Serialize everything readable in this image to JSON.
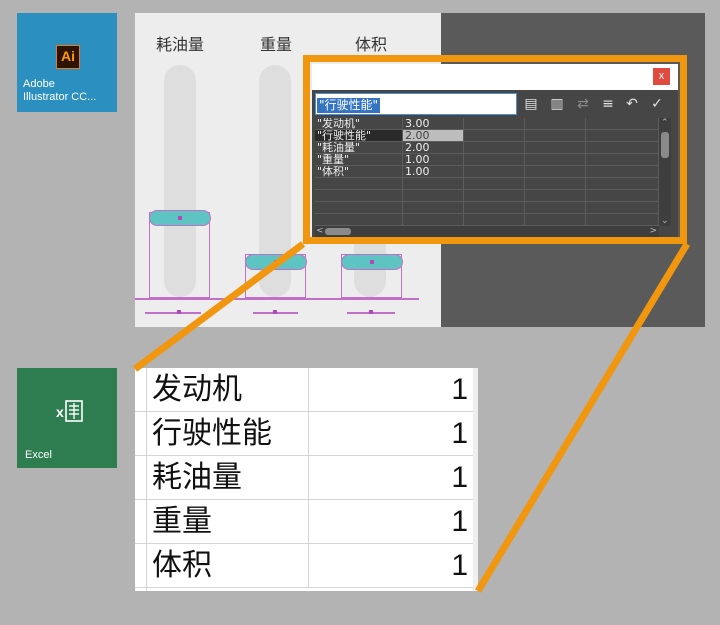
{
  "desktop": {
    "illustrator": {
      "logo": "Ai",
      "label_line1": "Adobe",
      "label_line2": "Illustrator CC...",
      "icon": "illustrator-icon"
    },
    "excel": {
      "label": "Excel",
      "icon": "excel-icon"
    }
  },
  "artboard": {
    "columns": [
      "耗油量",
      "重量",
      "体积"
    ]
  },
  "graph_dialog": {
    "close_label": "x",
    "entry_value": "\"行驶性能\"",
    "toolbar_icons": [
      "import-data-icon",
      "transpose-icon",
      "switch-xy-icon",
      "cell-style-icon",
      "revert-icon",
      "apply-icon"
    ],
    "rows": [
      {
        "label": "\"发动机\"",
        "value": "3.00"
      },
      {
        "label": "\"行驶性能\"",
        "value": "2.00"
      },
      {
        "label": "\"耗油量\"",
        "value": "2.00"
      },
      {
        "label": "\"重量\"",
        "value": "1.00"
      },
      {
        "label": "\"体积\"",
        "value": "1.00"
      }
    ]
  },
  "spreadsheet": {
    "rows": [
      {
        "name": "发动机",
        "value": "1"
      },
      {
        "name": "行驶性能",
        "value": "1"
      },
      {
        "name": "耗油量",
        "value": "1"
      },
      {
        "name": "重量",
        "value": "1"
      },
      {
        "name": "体积",
        "value": "1"
      }
    ]
  },
  "colors": {
    "highlight": "#f0960f",
    "illustrator_bg": "#2b8fc0",
    "excel_bg": "#2e7d51",
    "bar_fill": "#5ec4c2",
    "selection": "#c070c8"
  }
}
